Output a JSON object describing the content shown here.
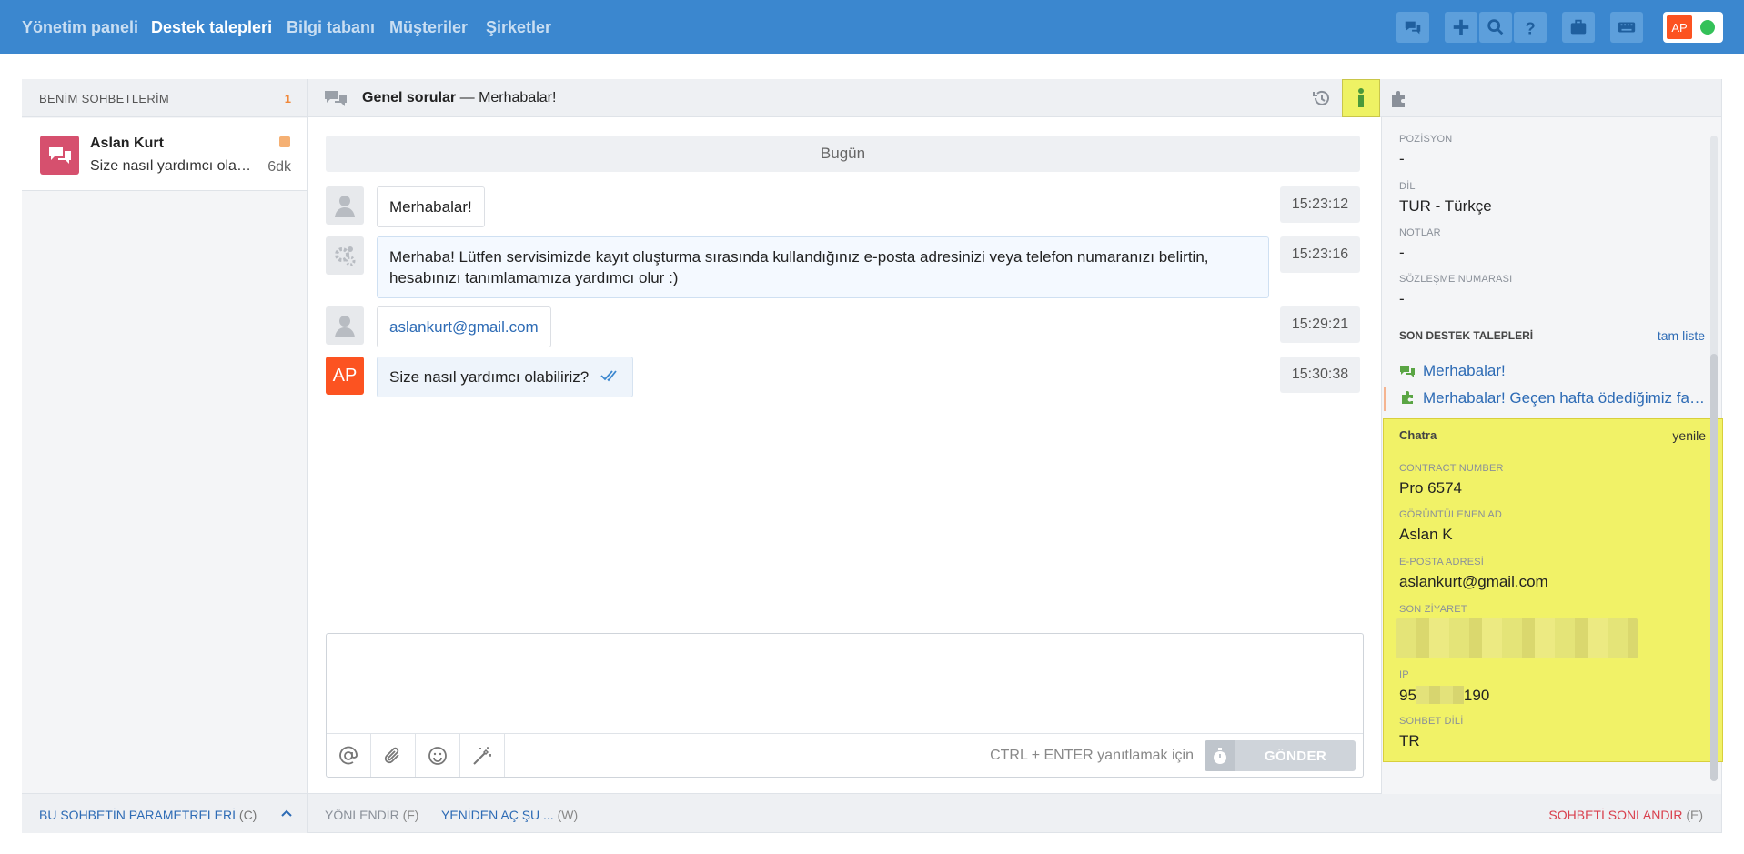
{
  "nav": {
    "items": [
      {
        "label": "Yönetim paneli"
      },
      {
        "label": "Destek talepleri"
      },
      {
        "label": "Bilgi tabanı"
      },
      {
        "label": "Müşteriler"
      },
      {
        "label": "Şirketler"
      }
    ],
    "user_initials": "AP",
    "status_color": "#34c159"
  },
  "left": {
    "header": "BENİM SOHBETLERİM",
    "count": "1",
    "chats": [
      {
        "name": "Aslan Kurt",
        "preview": "Size nasıl yardımcı olabiliriz?",
        "age": "6dk"
      }
    ],
    "footer_label": "BU SOHBETİN PARAMETRELERİ",
    "footer_key": "(C)"
  },
  "conversation": {
    "topic": "Genel sorular",
    "separator": "—",
    "subject": "Merhabalar!",
    "day": "Bugün",
    "messages": [
      {
        "text": "Merhabalar!",
        "time": "15:23:12"
      },
      {
        "text": "Merhaba! Lütfen servisimizde kayıt oluşturma sırasında kullandığınız e-posta adresinizi veya telefon numaranızı belirtin, hesabınızı tanımlamamıza yardımcı olur :)",
        "time": "15:23:16"
      },
      {
        "text": "aslankurt@gmail.com",
        "time": "15:29:21"
      },
      {
        "text": "Size nasıl yardımcı olabiliriz?",
        "time": "15:30:38",
        "avatar": "AP"
      }
    ],
    "composer_hint": "CTRL + ENTER yanıtlamak için",
    "send_label": "GÖNDER"
  },
  "footer": {
    "forward_label": "YÖNLENDİR",
    "forward_key": "(F)",
    "reopen_label": "YENİDEN AÇ ŞU ...",
    "reopen_key": "(W)",
    "close_label": "SOHBETİ SONLANDIR",
    "close_key": "(E)"
  },
  "info": {
    "fields": [
      {
        "label": "POZİSYON",
        "value": "-"
      },
      {
        "label": "DİL",
        "value": "TUR - Türkçe"
      },
      {
        "label": "NOTLAR",
        "value": "-"
      },
      {
        "label": "SÖZLEŞME NUMARASI",
        "value": "-"
      }
    ],
    "recent_header": "SON DESTEK TALEPLERİ",
    "recent_link": "tam liste",
    "recent": [
      {
        "title": "Merhabalar!"
      },
      {
        "title": "Merhabalar! Geçen hafta ödediğimiz fatura"
      }
    ],
    "chatra": {
      "header": "Chatra",
      "refresh": "yenile",
      "fields": [
        {
          "label": "CONTRACT NUMBER",
          "value": "Pro 6574"
        },
        {
          "label": "GÖRÜNTÜLENEN AD",
          "value": "Aslan K"
        },
        {
          "label": "E-POSTA ADRESİ",
          "value": "aslankurt@gmail.com"
        },
        {
          "label": "SON ZİYARET"
        },
        {
          "label": "IP",
          "value_start": "95",
          "value_end": "190"
        },
        {
          "label": "SOHBET DİLİ",
          "value": "TR"
        }
      ]
    }
  }
}
